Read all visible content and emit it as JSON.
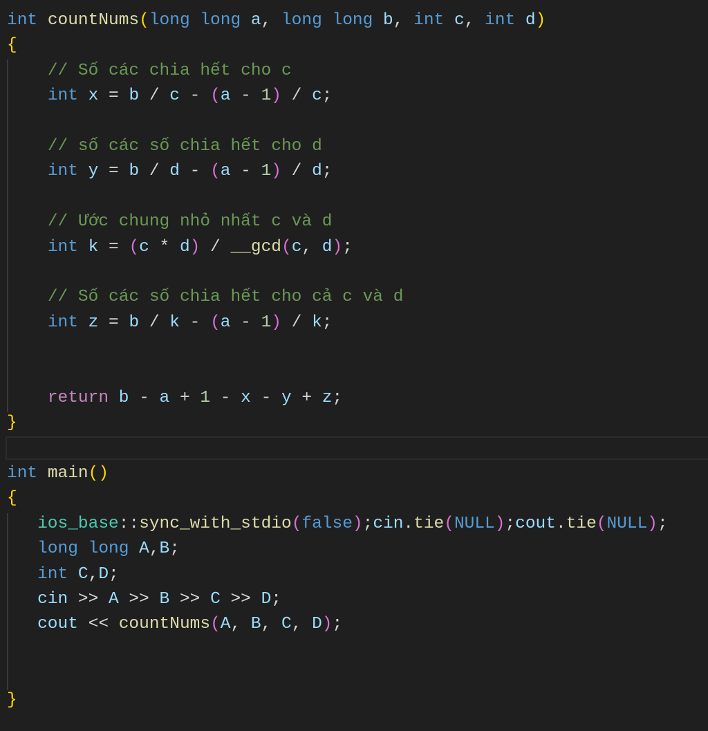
{
  "editor": {
    "current_line": 18,
    "colors": {
      "background": "#1f1f1f",
      "keyword": "#569cd6",
      "function": "#dcdcaa",
      "variable": "#9cdcfe",
      "comment": "#6a9955",
      "number": "#b5cea8",
      "bracket1": "#ffd700",
      "bracket2": "#da70d6",
      "bracket3": "#179fff",
      "control": "#c586c0"
    },
    "lines": [
      [
        [
          "kw",
          "int"
        ],
        [
          "txt",
          " "
        ],
        [
          "fn",
          "countNums"
        ],
        [
          "b1",
          "("
        ],
        [
          "kw",
          "long long"
        ],
        [
          "txt",
          " "
        ],
        [
          "var",
          "a"
        ],
        [
          "txt",
          ", "
        ],
        [
          "kw",
          "long long"
        ],
        [
          "txt",
          " "
        ],
        [
          "var",
          "b"
        ],
        [
          "txt",
          ", "
        ],
        [
          "kw",
          "int"
        ],
        [
          "txt",
          " "
        ],
        [
          "var",
          "c"
        ],
        [
          "txt",
          ", "
        ],
        [
          "kw",
          "int"
        ],
        [
          "txt",
          " "
        ],
        [
          "var",
          "d"
        ],
        [
          "b1",
          ")"
        ]
      ],
      [
        [
          "b1",
          "{"
        ]
      ],
      [
        [
          "txt",
          "    "
        ],
        [
          "cm",
          "// Số các chia hết cho c"
        ]
      ],
      [
        [
          "txt",
          "    "
        ],
        [
          "kw",
          "int"
        ],
        [
          "txt",
          " "
        ],
        [
          "var",
          "x"
        ],
        [
          "txt",
          " = "
        ],
        [
          "var",
          "b"
        ],
        [
          "txt",
          " / "
        ],
        [
          "var",
          "c"
        ],
        [
          "txt",
          " - "
        ],
        [
          "b2",
          "("
        ],
        [
          "var",
          "a"
        ],
        [
          "txt",
          " - "
        ],
        [
          "num",
          "1"
        ],
        [
          "b2",
          ")"
        ],
        [
          "txt",
          " / "
        ],
        [
          "var",
          "c"
        ],
        [
          "txt",
          ";"
        ]
      ],
      [],
      [
        [
          "txt",
          "    "
        ],
        [
          "cm",
          "// số các số chia hết cho d"
        ]
      ],
      [
        [
          "txt",
          "    "
        ],
        [
          "kw",
          "int"
        ],
        [
          "txt",
          " "
        ],
        [
          "var",
          "y"
        ],
        [
          "txt",
          " = "
        ],
        [
          "var",
          "b"
        ],
        [
          "txt",
          " / "
        ],
        [
          "var",
          "d"
        ],
        [
          "txt",
          " - "
        ],
        [
          "b2",
          "("
        ],
        [
          "var",
          "a"
        ],
        [
          "txt",
          " - "
        ],
        [
          "num",
          "1"
        ],
        [
          "b2",
          ")"
        ],
        [
          "txt",
          " / "
        ],
        [
          "var",
          "d"
        ],
        [
          "txt",
          ";"
        ]
      ],
      [],
      [
        [
          "txt",
          "    "
        ],
        [
          "cm",
          "// Ước chung nhỏ nhất c và d"
        ]
      ],
      [
        [
          "txt",
          "    "
        ],
        [
          "kw",
          "int"
        ],
        [
          "txt",
          " "
        ],
        [
          "var",
          "k"
        ],
        [
          "txt",
          " = "
        ],
        [
          "b2",
          "("
        ],
        [
          "var",
          "c"
        ],
        [
          "txt",
          " * "
        ],
        [
          "var",
          "d"
        ],
        [
          "b2",
          ")"
        ],
        [
          "txt",
          " / "
        ],
        [
          "fn",
          "__gcd"
        ],
        [
          "b2",
          "("
        ],
        [
          "var",
          "c"
        ],
        [
          "txt",
          ", "
        ],
        [
          "var",
          "d"
        ],
        [
          "b2",
          ")"
        ],
        [
          "txt",
          ";"
        ]
      ],
      [],
      [
        [
          "txt",
          "    "
        ],
        [
          "cm",
          "// Số các số chia hết cho cả c và d"
        ]
      ],
      [
        [
          "txt",
          "    "
        ],
        [
          "kw",
          "int"
        ],
        [
          "txt",
          " "
        ],
        [
          "var",
          "z"
        ],
        [
          "txt",
          " = "
        ],
        [
          "var",
          "b"
        ],
        [
          "txt",
          " / "
        ],
        [
          "var",
          "k"
        ],
        [
          "txt",
          " - "
        ],
        [
          "b2",
          "("
        ],
        [
          "var",
          "a"
        ],
        [
          "txt",
          " - "
        ],
        [
          "num",
          "1"
        ],
        [
          "b2",
          ")"
        ],
        [
          "txt",
          " / "
        ],
        [
          "var",
          "k"
        ],
        [
          "txt",
          ";"
        ]
      ],
      [],
      [],
      [
        [
          "txt",
          "    "
        ],
        [
          "ctl",
          "return"
        ],
        [
          "txt",
          " "
        ],
        [
          "var",
          "b"
        ],
        [
          "txt",
          " - "
        ],
        [
          "var",
          "a"
        ],
        [
          "txt",
          " + "
        ],
        [
          "num",
          "1"
        ],
        [
          "txt",
          " - "
        ],
        [
          "var",
          "x"
        ],
        [
          "txt",
          " - "
        ],
        [
          "var",
          "y"
        ],
        [
          "txt",
          " + "
        ],
        [
          "var",
          "z"
        ],
        [
          "txt",
          ";"
        ]
      ],
      [
        [
          "b1",
          "}"
        ]
      ],
      [],
      [
        [
          "kw",
          "int"
        ],
        [
          "txt",
          " "
        ],
        [
          "fn",
          "main"
        ],
        [
          "b1",
          "()"
        ]
      ],
      [
        [
          "b1",
          "{"
        ]
      ],
      [
        [
          "txt",
          "   "
        ],
        [
          "type",
          "ios_base"
        ],
        [
          "txt",
          "::"
        ],
        [
          "fn",
          "sync_with_stdio"
        ],
        [
          "b2",
          "("
        ],
        [
          "kw",
          "false"
        ],
        [
          "b2",
          ")"
        ],
        [
          "txt",
          ";"
        ],
        [
          "var",
          "cin"
        ],
        [
          "txt",
          "."
        ],
        [
          "fn",
          "tie"
        ],
        [
          "b2",
          "("
        ],
        [
          "kw",
          "NULL"
        ],
        [
          "b2",
          ")"
        ],
        [
          "txt",
          ";"
        ],
        [
          "var",
          "cout"
        ],
        [
          "txt",
          "."
        ],
        [
          "fn",
          "tie"
        ],
        [
          "b2",
          "("
        ],
        [
          "kw",
          "NULL"
        ],
        [
          "b2",
          ")"
        ],
        [
          "txt",
          ";"
        ]
      ],
      [
        [
          "txt",
          "   "
        ],
        [
          "kw",
          "long long"
        ],
        [
          "txt",
          " "
        ],
        [
          "var",
          "A"
        ],
        [
          "txt",
          ","
        ],
        [
          "var",
          "B"
        ],
        [
          "txt",
          ";"
        ]
      ],
      [
        [
          "txt",
          "   "
        ],
        [
          "kw",
          "int"
        ],
        [
          "txt",
          " "
        ],
        [
          "var",
          "C"
        ],
        [
          "txt",
          ","
        ],
        [
          "var",
          "D"
        ],
        [
          "txt",
          ";"
        ]
      ],
      [
        [
          "txt",
          "   "
        ],
        [
          "var",
          "cin"
        ],
        [
          "txt",
          " >> "
        ],
        [
          "var",
          "A"
        ],
        [
          "txt",
          " >> "
        ],
        [
          "var",
          "B"
        ],
        [
          "txt",
          " >> "
        ],
        [
          "var",
          "C"
        ],
        [
          "txt",
          " >> "
        ],
        [
          "var",
          "D"
        ],
        [
          "txt",
          ";"
        ]
      ],
      [
        [
          "txt",
          "   "
        ],
        [
          "var",
          "cout"
        ],
        [
          "txt",
          " << "
        ],
        [
          "fn",
          "countNums"
        ],
        [
          "b2",
          "("
        ],
        [
          "var",
          "A"
        ],
        [
          "txt",
          ", "
        ],
        [
          "var",
          "B"
        ],
        [
          "txt",
          ", "
        ],
        [
          "var",
          "C"
        ],
        [
          "txt",
          ", "
        ],
        [
          "var",
          "D"
        ],
        [
          "b2",
          ")"
        ],
        [
          "txt",
          ";"
        ]
      ],
      [],
      [],
      [
        [
          "b1",
          "}"
        ]
      ]
    ]
  }
}
